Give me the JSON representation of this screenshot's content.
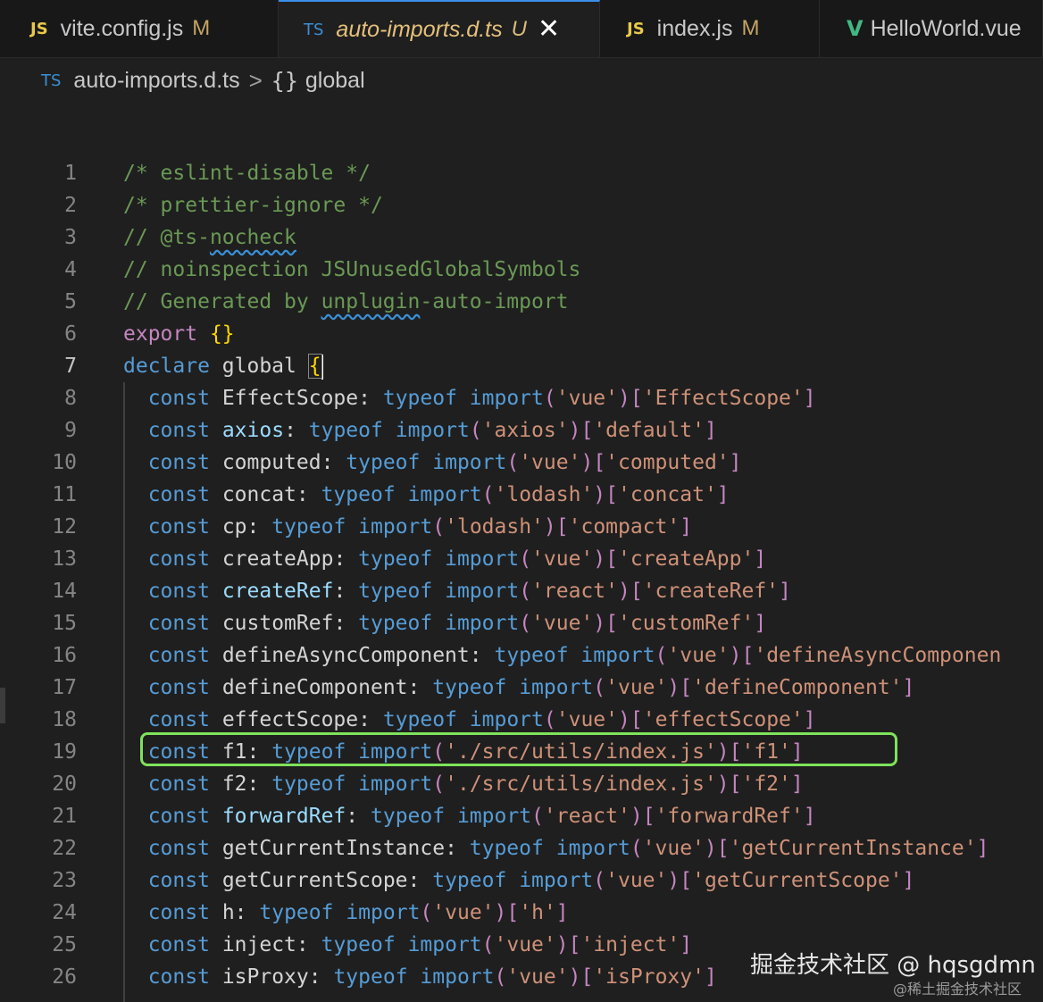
{
  "tabs": [
    {
      "icon": "JS",
      "name": "vite.config.js",
      "status": "M"
    },
    {
      "icon": "TS",
      "name": "auto-imports.d.ts",
      "status": "U",
      "close": "✕"
    },
    {
      "icon": "JS",
      "name": "index.js",
      "status": "M"
    },
    {
      "icon": "V",
      "name": "HelloWorld.vue",
      "status": ""
    }
  ],
  "breadcrumb": {
    "icon": "TS",
    "file": "auto-imports.d.ts",
    "sep": ">",
    "symbol_icon": "{}",
    "symbol": "global"
  },
  "editor": {
    "current_line": 7,
    "line_numbers": [
      "1",
      "2",
      "3",
      "4",
      "5",
      "6",
      "7",
      "8",
      "9",
      "10",
      "11",
      "12",
      "13",
      "14",
      "15",
      "16",
      "17",
      "18",
      "19",
      "20",
      "21",
      "22",
      "23",
      "24",
      "25",
      "26"
    ],
    "header_lines": [
      "/* eslint-disable */",
      "/* prettier-ignore */",
      "// @ts-nocheck",
      "// noinspection JSUnusedGlobalSymbols",
      "// Generated by unplugin-auto-import",
      "export {}",
      "declare global {"
    ],
    "decl_lines": [
      {
        "name": "EffectScope",
        "module": "'vue'",
        "key": "'EffectScope'"
      },
      {
        "name": "axios",
        "module": "'axios'",
        "key": "'default'"
      },
      {
        "name": "computed",
        "module": "'vue'",
        "key": "'computed'"
      },
      {
        "name": "concat",
        "module": "'lodash'",
        "key": "'concat'"
      },
      {
        "name": "cp",
        "module": "'lodash'",
        "key": "'compact'"
      },
      {
        "name": "createApp",
        "module": "'vue'",
        "key": "'createApp'"
      },
      {
        "name": "createRef",
        "module": "'react'",
        "key": "'createRef'"
      },
      {
        "name": "customRef",
        "module": "'vue'",
        "key": "'customRef'"
      },
      {
        "name": "defineAsyncComponent",
        "module": "'vue'",
        "key": "'defineAsyncComponen"
      },
      {
        "name": "defineComponent",
        "module": "'vue'",
        "key": "'defineComponent'"
      },
      {
        "name": "effectScope",
        "module": "'vue'",
        "key": "'effectScope'"
      },
      {
        "name": "f1",
        "module": "'./src/utils/index.js'",
        "key": "'f1'"
      },
      {
        "name": "f2",
        "module": "'./src/utils/index.js'",
        "key": "'f2'"
      },
      {
        "name": "forwardRef",
        "module": "'react'",
        "key": "'forwardRef'"
      },
      {
        "name": "getCurrentInstance",
        "module": "'vue'",
        "key": "'getCurrentInstance'"
      },
      {
        "name": "getCurrentScope",
        "module": "'vue'",
        "key": "'getCurrentScope'"
      },
      {
        "name": "h",
        "module": "'vue'",
        "key": "'h'"
      },
      {
        "name": "inject",
        "module": "'vue'",
        "key": "'inject'"
      },
      {
        "name": "isProxy",
        "module": "'vue'",
        "key": "'isProxy'"
      }
    ],
    "keywords": {
      "const": "const",
      "typeof": "typeof",
      "import": "import"
    }
  },
  "watermark": {
    "main": "掘金技术社区 @ hqsgdmn",
    "sub": "@稀土掘金技术社区"
  },
  "colors": {
    "highlight_box": "#7ee35a",
    "accent": "#3b8eea"
  }
}
